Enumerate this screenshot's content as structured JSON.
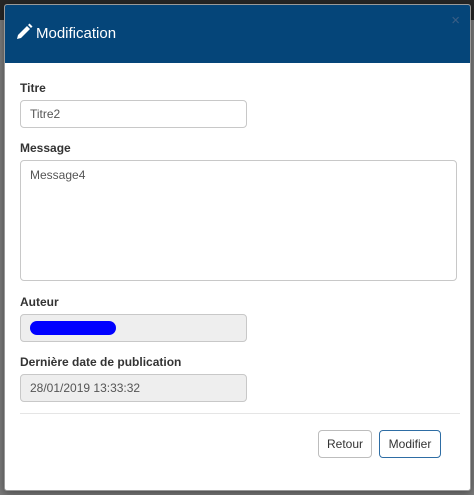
{
  "modal": {
    "title": "Modification",
    "close_glyph": "×",
    "header_color": "#054579"
  },
  "form": {
    "titre": {
      "label": "Titre",
      "value": "Titre2"
    },
    "message": {
      "label": "Message",
      "value": "Message4"
    },
    "auteur": {
      "label": "Auteur",
      "value_redacted": true
    },
    "derniere_date": {
      "label": "Dernière date de publication",
      "value": "28/01/2019 13:33:32"
    }
  },
  "footer": {
    "retour_label": "Retour",
    "modifier_label": "Modifier"
  },
  "icons": {
    "header": "pencil-icon",
    "close": "close-icon"
  }
}
